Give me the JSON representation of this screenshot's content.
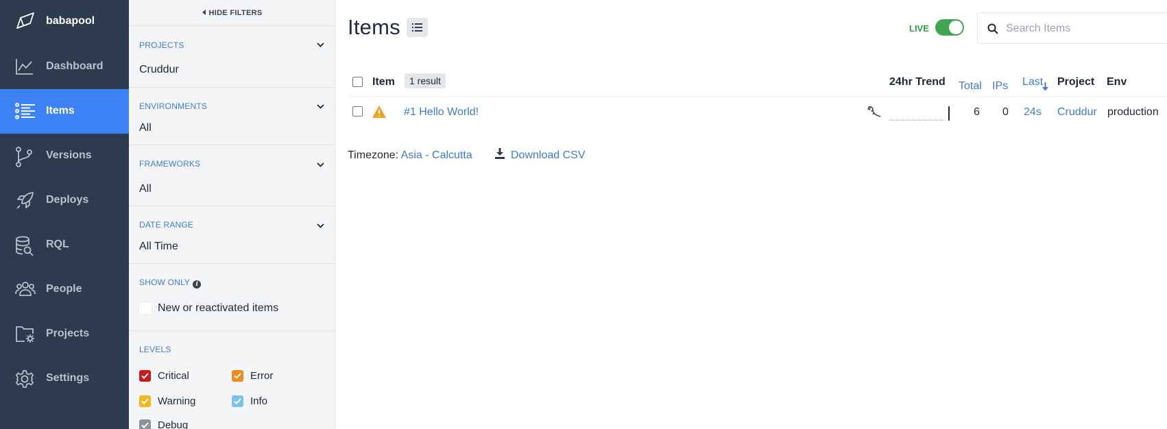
{
  "brand": {
    "name": "babapool"
  },
  "nav": {
    "items": [
      {
        "label": "Dashboard",
        "icon": "chart-line-icon",
        "active": false
      },
      {
        "label": "Items",
        "icon": "list-icon",
        "active": true
      },
      {
        "label": "Versions",
        "icon": "git-branch-icon",
        "active": false
      },
      {
        "label": "Deploys",
        "icon": "rocket-icon",
        "active": false
      },
      {
        "label": "RQL",
        "icon": "database-search-icon",
        "active": false
      },
      {
        "label": "People",
        "icon": "people-icon",
        "active": false
      },
      {
        "label": "Projects",
        "icon": "folder-gear-icon",
        "active": false
      },
      {
        "label": "Settings",
        "icon": "gear-icon",
        "active": false
      }
    ]
  },
  "filters": {
    "hide_label": "HIDE FILTERS",
    "projects": {
      "title": "PROJECTS",
      "value": "Cruddur"
    },
    "environments": {
      "title": "ENVIRONMENTS",
      "value": "All"
    },
    "frameworks": {
      "title": "FRAMEWORKS",
      "value": "All"
    },
    "date_range": {
      "title": "DATE RANGE",
      "value": "All Time"
    },
    "show_only": {
      "title": "SHOW ONLY",
      "option": "New or reactivated items",
      "checked": false
    },
    "levels": {
      "title": "LEVELS",
      "items": [
        {
          "label": "Critical",
          "color": "#c81c1c",
          "checked": true
        },
        {
          "label": "Error",
          "color": "#f08a1c",
          "checked": true
        },
        {
          "label": "Warning",
          "color": "#f5b81c",
          "checked": true
        },
        {
          "label": "Info",
          "color": "#7cc1e8",
          "checked": true
        },
        {
          "label": "Debug",
          "color": "#8a929c",
          "checked": true
        }
      ]
    }
  },
  "main": {
    "title": "Items",
    "live": {
      "label": "LIVE",
      "on": true
    },
    "search": {
      "placeholder": "Search Items",
      "value": ""
    },
    "table": {
      "headers": {
        "item": "Item",
        "result_count": "1 result",
        "trend": "24hr Trend",
        "total": "Total",
        "ips": "IPs",
        "last": "Last",
        "project": "Project",
        "env": "Env"
      },
      "rows": [
        {
          "level_icon": "warning-triangle-icon",
          "title": "#1 Hello World!",
          "framework_icon": "framework-icon",
          "total": "6",
          "ips": "0",
          "last": "24s",
          "project": "Cruddur",
          "env": "production"
        }
      ]
    },
    "footer": {
      "timezone_label": "Timezone:",
      "timezone_value": "Asia - Calcutta",
      "download_label": "Download CSV"
    }
  }
}
